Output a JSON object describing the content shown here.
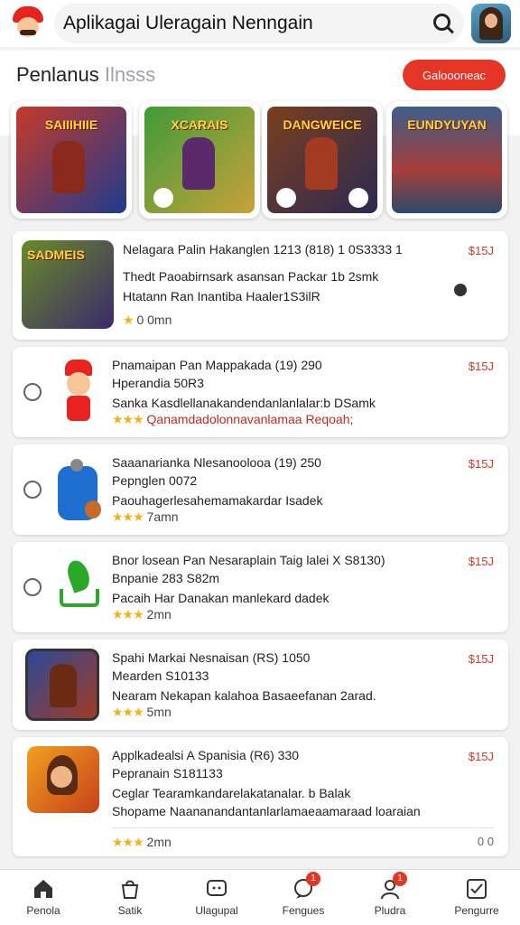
{
  "header": {
    "search_text": "Aplikagai Uleragain Nenngain",
    "search_icon": "search-icon",
    "logo_icon": "mascot-logo-icon",
    "avatar_icon": "user-avatar"
  },
  "section": {
    "title": "Penlanus",
    "subtitle": "Ilnsss",
    "see_all_label": "Galoooneac"
  },
  "featured": [
    {
      "title": "SAIIIHIIE",
      "colors": [
        "#c63a2a",
        "#1f3b8c"
      ]
    },
    {
      "title": "XCARAIS",
      "colors": [
        "#3f9b3a",
        "#c8a23a"
      ]
    },
    {
      "title": "DANGWEICE",
      "colors": [
        "#7a3f1e",
        "#2c2a52"
      ]
    },
    {
      "title": "EUNDYUYAN",
      "colors": [
        "#3d5d8a",
        "#a63f3a"
      ]
    }
  ],
  "list": [
    {
      "title": "Nelagara Palin Hakanglen 1213 (818) 1 0S3333 1",
      "subtitle": "Thedt Paoabirnsark asansan Packar 1b 2smk",
      "desc": "Htatann Ran Inantiba Haaler1S3ilR",
      "price": "$15J",
      "stars": "★",
      "rating": "0 0mn",
      "thumb_title": "SADMEIS"
    },
    {
      "title": "Pnamaipan Pan Mappakada (19) 290",
      "subtitle": "Hperandia 50R3",
      "desc": "Sanka Kasdlellanakandendanlanlalar:b DSamk",
      "price": "$15J",
      "stars": "★★★",
      "rating": "Qanamdadolonnavanlamaa Reqoah;"
    },
    {
      "title": "Saaanarianka Nlesanoolooa (19) 250",
      "subtitle": "Pepnglen 0072",
      "desc": "Paouhagerlesahemamakardar Isadek",
      "price": "$15J",
      "stars": "★★★",
      "rating": "7amn"
    },
    {
      "title": "Bnor losean Pan Nesaraplain Taig lalei X S8130)",
      "subtitle": "Bnpanie 283 S82m",
      "desc": "Pacaih Har Danakan manlekard dadek",
      "price": "$15J",
      "stars": "★★★",
      "rating": "2mn"
    },
    {
      "title": "Spahi Markai Nesnaisan (RS) 1050",
      "subtitle": "Mearden S10133",
      "desc": "Nearam Nekapan kalahoa Basaeefanan 2arad.",
      "price": "$15J",
      "stars": "★★★",
      "rating": "5mn"
    },
    {
      "title": "Applkadealsi A Spanisia (R6) 330",
      "subtitle": "Pepranain S181133",
      "desc": "Ceglar Tearamkandarelakatanalar. b Balak",
      "desc2": "Shopame Naananandantanlarlamaeaamaraad loaraian",
      "price": "$15J",
      "stars": "★★★",
      "rating": "2mn",
      "extra": "0 0"
    }
  ],
  "nav": [
    {
      "label": "Penola",
      "icon": "home-icon"
    },
    {
      "label": "Satik",
      "icon": "bag-icon"
    },
    {
      "label": "Ulagupal",
      "icon": "chat-icon"
    },
    {
      "label": "Fengues",
      "icon": "message-icon",
      "badge": "1"
    },
    {
      "label": "Pludra",
      "icon": "profile-icon",
      "badge": "1"
    },
    {
      "label": "Pengurre",
      "icon": "check-box-icon"
    }
  ],
  "colors": {
    "accent": "#e53527",
    "price": "#d23a2a",
    "star": "#f2b414"
  }
}
